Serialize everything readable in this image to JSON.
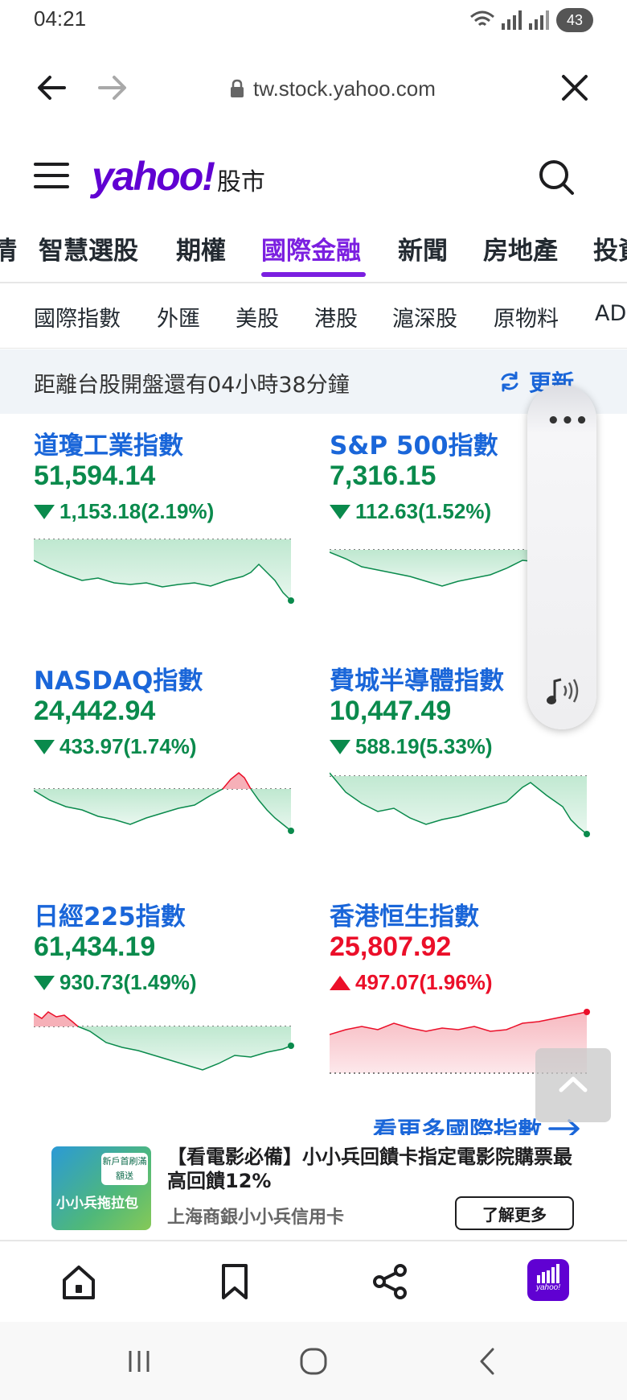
{
  "status_bar": {
    "time": "04:21",
    "battery": "43"
  },
  "browser": {
    "url": "tw.stock.yahoo.com"
  },
  "header": {
    "logo": "yahoo!",
    "logo_sub": "股市"
  },
  "main_tabs": [
    "情",
    "智慧選股",
    "期權",
    "國際金融",
    "新聞",
    "房地產",
    "投資"
  ],
  "active_main_tab": "國際金融",
  "sub_tabs": [
    "國際指數",
    "外匯",
    "美股",
    "港股",
    "滬深股",
    "原物料",
    "AD"
  ],
  "notice": {
    "text": "距離台股開盤還有04小時38分鐘",
    "refresh_label": "更新"
  },
  "indices": [
    {
      "name": "道瓊工業指數",
      "value": "51,594.14",
      "change": "1,153.18(2.19%)",
      "direction": "down"
    },
    {
      "name": "S&P 500指數",
      "value": "7,316.15",
      "change": "112.63(1.52%)",
      "direction": "down"
    },
    {
      "name": "NASDAQ指數",
      "value": "24,442.94",
      "change": "433.97(1.74%)",
      "direction": "down"
    },
    {
      "name": "費城半導體指數",
      "value": "10,447.49",
      "change": "588.19(5.33%)",
      "direction": "down"
    },
    {
      "name": "日經225指數",
      "value": "61,434.19",
      "change": "930.73(1.49%)",
      "direction": "down"
    },
    {
      "name": "香港恒生指數",
      "value": "25,807.92",
      "change": "497.07(1.96%)",
      "direction": "up"
    }
  ],
  "more_link": "看更多國際指數",
  "ad": {
    "title": "【看電影必備】小小兵回饋卡指定電影院購票最高回饋12%",
    "sponsor": "上海商銀小小兵信用卡",
    "button": "了解更多",
    "thumb_text": "小小兵拖拉包",
    "thumb_badge": "新戶首刷滿額送"
  },
  "yahoo_app_label": "yahoo!",
  "colors": {
    "accent": "#7b1fe0",
    "link": "#1a66d9",
    "down": "#0a8a4c",
    "up": "#eb0f29"
  },
  "icons": [
    "back-arrow-icon",
    "forward-arrow-icon",
    "lock-icon",
    "close-icon",
    "hamburger-icon",
    "search-icon",
    "refresh-icon",
    "arrow-right-icon",
    "chevron-up-icon",
    "home-icon",
    "bookmark-icon",
    "share-icon",
    "audio-icon",
    "recent-apps-icon",
    "home-circle-icon",
    "back-chevron-icon"
  ]
}
